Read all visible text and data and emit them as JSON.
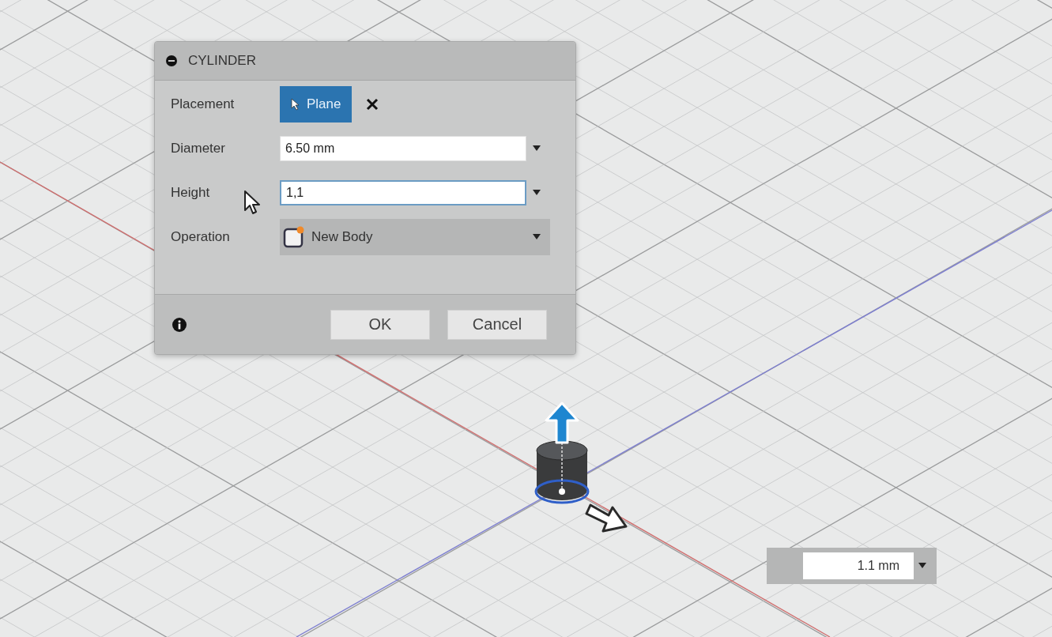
{
  "dialog": {
    "title": "CYLINDER",
    "rows": [
      {
        "kind": "selection",
        "label": "Placement",
        "value": "Plane",
        "selected": true
      },
      {
        "kind": "input",
        "label": "Diameter",
        "value": "6.50 mm",
        "focused": false
      },
      {
        "kind": "input",
        "label": "Height",
        "value": "1,1",
        "focused": true
      },
      {
        "kind": "dropdown",
        "label": "Operation",
        "value": "New Body"
      }
    ],
    "buttons": [
      "OK",
      "Cancel"
    ]
  },
  "value_field": {
    "value": "1.1 mm"
  }
}
